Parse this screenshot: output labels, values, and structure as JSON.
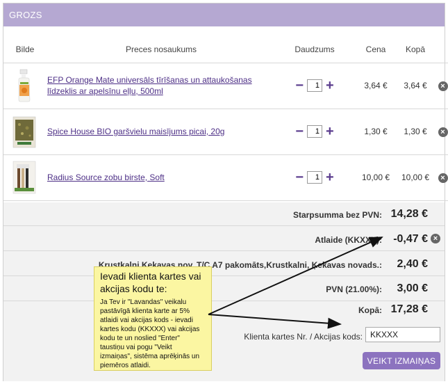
{
  "header": {
    "title": "GROZS"
  },
  "table": {
    "columns": [
      "Bilde",
      "Preces nosaukums",
      "Daudzums",
      "Cena",
      "Kopā"
    ],
    "rows": [
      {
        "name": "EFP Orange Mate universāls tīrīšanas un attaukošanas līdzeklis ar apelsīnu eļļu, 500ml",
        "qty": "1",
        "price": "3,64 €",
        "total": "3,64 €",
        "image": "cleaning-spray-bottle"
      },
      {
        "name": "Spice House BIO garšvielu maisījums picai, 20g",
        "qty": "1",
        "price": "1,30 €",
        "total": "1,30 €",
        "image": "spice-packet"
      },
      {
        "name": "Radius Source zobu birste, Soft",
        "qty": "1",
        "price": "10,00 €",
        "total": "10,00 €",
        "image": "toothbrush-pack"
      }
    ],
    "minus_symbol": "−",
    "plus_symbol": "+",
    "remove_symbol": "×"
  },
  "summary": {
    "subtotal_label": "Starpsumma bez PVN:",
    "subtotal_value": "14,28 €",
    "discount_label": "Atlaide (KKXXX):",
    "discount_value": "-0,47 €",
    "shipping_label": "Krustkalni,Ķekavas nov. T/C A7 pakomāts,Krustkalni, Ķekavas novads.:",
    "shipping_value": "2,40 €",
    "vat_label": "PVN (21.00%):",
    "vat_value": "3,00 €",
    "total_label": "Kopā:",
    "total_value": "17,28 €"
  },
  "coupon": {
    "label": "Klienta kartes Nr. / Akcijas kods:",
    "value": "KKXXX",
    "button": "VEIKT IZMAIŅAS"
  },
  "callout": {
    "title": "Ievadi klienta kartes vai akcijas kodu te:",
    "body": "Ja Tev ir \"Lavandas\" veikalu pastāvīgā klienta karte ar 5% atlaidi vai akcijas kods - ievadi kartes kodu (KKXXX)  vai akcijas kodu te un noslied \"Enter\" taustiņu vai pogu \"Veikt izmaiņas\", sistēma aprēķinās un piemēros atlaidi."
  },
  "colors": {
    "header": "#b5a8d2",
    "accent": "#5b3d8e",
    "button": "#8c73bf",
    "callout": "#fbf6a2"
  }
}
